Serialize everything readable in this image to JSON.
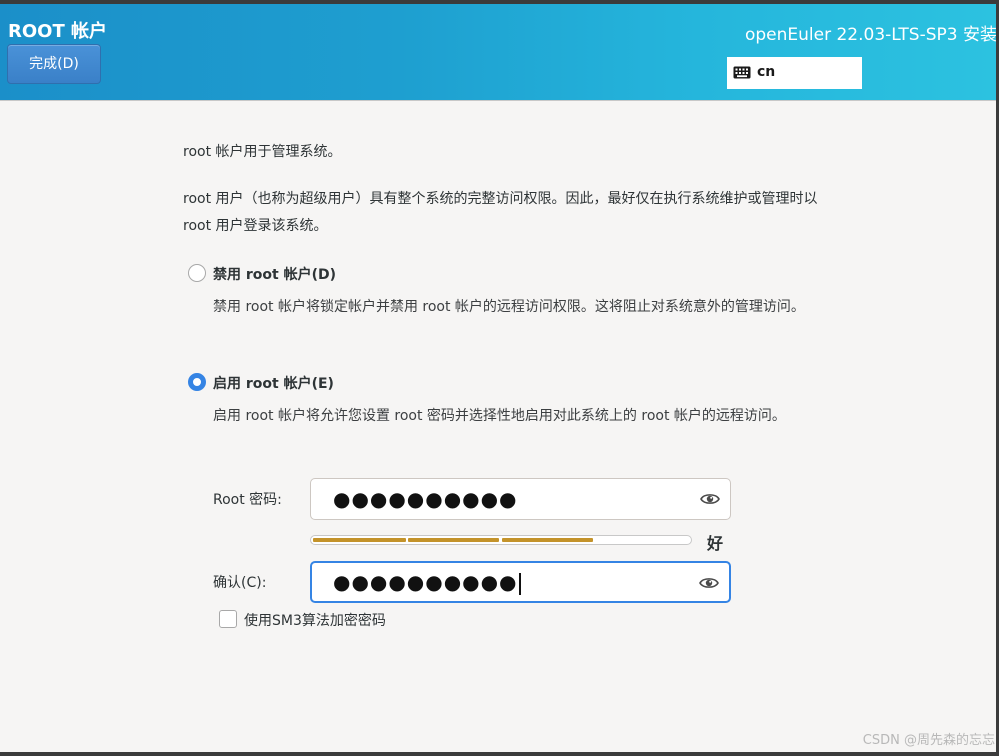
{
  "header": {
    "title": "ROOT 帐户",
    "done_button": "完成(D)",
    "product_title": "openEuler 22.03-LTS-SP3 安装",
    "keyboard_layout": "cn",
    "gradient_start": "#1b8fc9",
    "gradient_end": "#2cc2e0"
  },
  "intro": {
    "line1": "root 帐户用于管理系统。",
    "line2": "root 用户（也称为超级用户）具有整个系统的完整访问权限。因此，最好仅在执行系统维护或管理时以 root 用户登录该系统。"
  },
  "options": [
    {
      "label": "禁用 root 帐户(D)",
      "description": "禁用 root 帐户将锁定帐户并禁用 root 帐户的远程访问权限。这将阻止对系统意外的管理访问。",
      "selected": false
    },
    {
      "label": "启用 root 帐户(E)",
      "description": "启用 root 帐户将允许您设置 root 密码并选择性地启用对此系统上的 root 帐户的远程访问。",
      "selected": true
    }
  ],
  "password": {
    "label": "Root 密码:",
    "value": "●●●●●●●●●●",
    "reveal_icon": "eye-icon"
  },
  "confirm": {
    "label": "确认(C):",
    "value": "●●●●●●●●●●",
    "reveal_icon": "eye-icon"
  },
  "strength": {
    "label": "好",
    "filled_segments": 3,
    "total_segments": 4,
    "color": "#c4932a"
  },
  "sm3_checkbox": {
    "label": "使用SM3算法加密密码",
    "checked": false
  },
  "watermark": "CSDN @周先森的忘忘",
  "accent_color": "#3584e4"
}
